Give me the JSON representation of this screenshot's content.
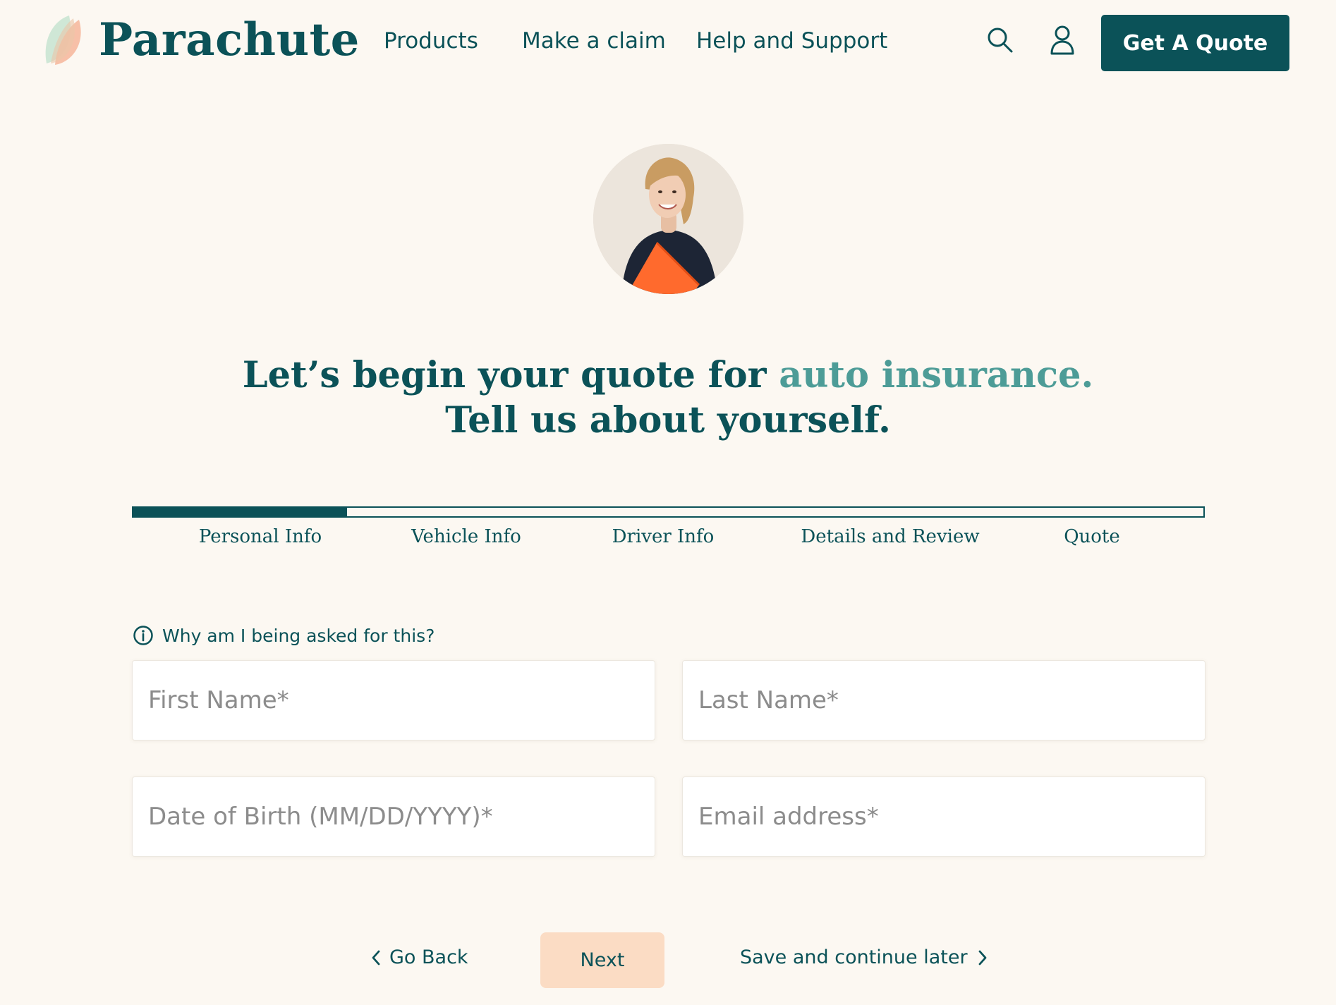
{
  "brand": {
    "name": "Parachute",
    "logo_icon": "parachute-leaf-logo",
    "colors": {
      "primary": "#0b5258",
      "accent": "#4d9c97",
      "next_button": "#fbdcc4",
      "background": "#fcf8f2"
    }
  },
  "header": {
    "nav": [
      "Products",
      "Make a claim",
      "Help and Support"
    ],
    "search_icon": "search-icon",
    "account_icon": "user-icon",
    "cta_label": "Get A Quote"
  },
  "avatar": {
    "icon": "agent-avatar"
  },
  "headline": {
    "line1_prefix": "Let’s begin your quote for ",
    "line1_accent": "auto insurance.",
    "line2": "Tell us about yourself."
  },
  "progress": {
    "current_step": 1,
    "fraction_complete": 0.2,
    "steps": [
      "Personal Info",
      "Vehicle Info",
      "Driver Info",
      "Details and Review",
      "Quote"
    ]
  },
  "form": {
    "why_label": "Why am I being asked for this?",
    "fields": {
      "first_name": {
        "placeholder": "First Name*",
        "value": ""
      },
      "last_name": {
        "placeholder": "Last Name*",
        "value": ""
      },
      "dob": {
        "placeholder": "Date of Birth (MM/DD/YYYY)*",
        "value": ""
      },
      "email": {
        "placeholder": "Email address*",
        "value": ""
      }
    }
  },
  "footer_nav": {
    "back_label": "Go Back",
    "next_label": "Next",
    "save_label": "Save and continue later"
  }
}
